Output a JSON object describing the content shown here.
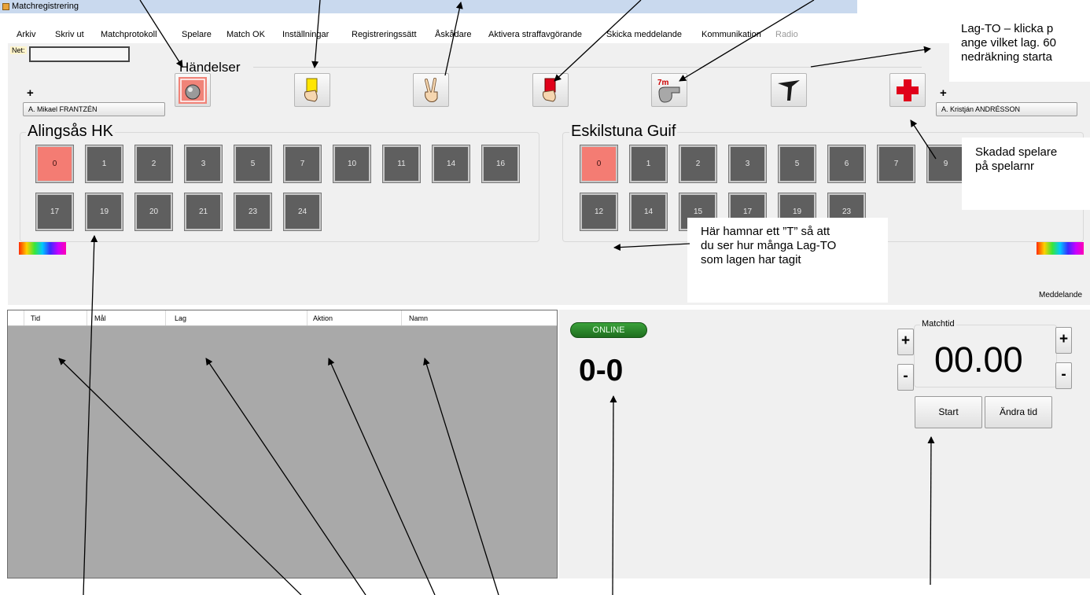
{
  "window": {
    "title": "Matchregistrering"
  },
  "menu": [
    "Arkiv",
    "Skriv ut",
    "Matchprotokoll",
    "Spelare",
    "Match OK",
    "Inställningar",
    "Registreringssätt",
    "Åskådare",
    "Aktivera straffavgörande",
    "Skicka meddelande",
    "Kommunikation",
    "Radio"
  ],
  "net_label": "Net:",
  "events": {
    "title": "Händelser",
    "buttons": [
      "goal-icon",
      "yellow-card-icon",
      "peace-hand-icon",
      "red-card-icon",
      "penalty-7m-whistle-icon",
      "timeout-t-icon",
      "injury-cross-icon"
    ]
  },
  "home": {
    "plus": "+",
    "coach": "A. Mikael FRANTZÉN",
    "name": "Alingsås HK",
    "players_row1": [
      "0",
      "1",
      "2",
      "3",
      "5",
      "7",
      "10",
      "11",
      "14",
      "16"
    ],
    "players_row2": [
      "17",
      "19",
      "20",
      "21",
      "23",
      "24"
    ]
  },
  "away": {
    "plus": "+",
    "coach": "A. Kristján ANDRÉSSON",
    "name": "Eskilstuna Guif",
    "players_row1": [
      "0",
      "1",
      "2",
      "3",
      "5",
      "6",
      "7",
      "9"
    ],
    "players_row2": [
      "12",
      "14",
      "15",
      "17",
      "19",
      "23"
    ]
  },
  "callouts": {
    "lag_to": [
      "Lag-TO – klicka p",
      "ange vilket lag. 60",
      "nedräkning starta"
    ],
    "injured": [
      "Skadad spelare",
      "på spelarnr"
    ],
    "timeout_info": [
      "Här hamnar ett ”T” så att",
      "du ser hur många Lag-TO",
      "som lagen har tagit"
    ]
  },
  "meddelande": "Meddelande",
  "log": {
    "columns": [
      "Tid",
      "Mål",
      "Lag",
      "Aktion",
      "Namn"
    ]
  },
  "status": {
    "online": "ONLINE",
    "score": "0-0"
  },
  "matchtime": {
    "label": "Matchtid",
    "clock": "00.00",
    "plus": "+",
    "minus": "-",
    "start": "Start",
    "change": "Ändra tid"
  },
  "colors": {
    "selected_player": "#f47c73",
    "player": "#5f5f5f",
    "online": "#2e8b2e"
  }
}
